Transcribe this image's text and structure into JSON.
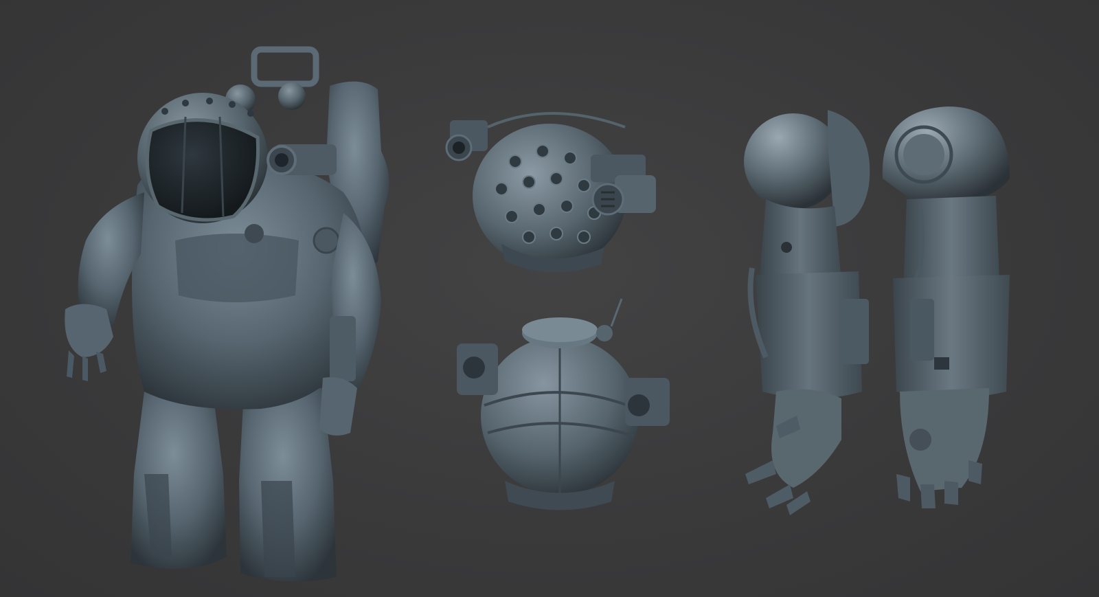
{
  "scene": {
    "background_color": "#3b3b3c",
    "model_color": "#5f6f7a",
    "model_shadow_color": "#2b3238",
    "model_highlight_color": "#8a9aa5",
    "visor_color": "#1c2226"
  },
  "renders": [
    {
      "name": "full-suit-render"
    },
    {
      "name": "helmet-top-render"
    },
    {
      "name": "helmet-front-render"
    },
    {
      "name": "arm-side-render"
    },
    {
      "name": "arm-back-render"
    }
  ]
}
